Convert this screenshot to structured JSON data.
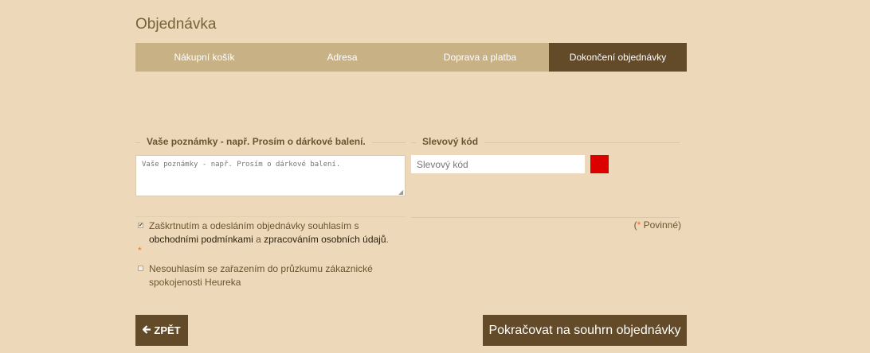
{
  "page": {
    "title": "Objednávka"
  },
  "steps": [
    {
      "label": "Nákupní košík",
      "active": false
    },
    {
      "label": "Adresa",
      "active": false
    },
    {
      "label": "Doprava a platba",
      "active": false
    },
    {
      "label": "Dokončení objednávky",
      "active": true
    }
  ],
  "notes": {
    "legend": "Vaše poznámky - např. Prosím o dárkové balení.",
    "placeholder": "Vaše poznámky - např. Prosím o dárkové balení."
  },
  "discount": {
    "legend": "Slevový kód",
    "placeholder": "Slevový kód",
    "submit_color": "#dd0000"
  },
  "required": {
    "star": "*",
    "label": " Povinné)",
    "open_paren": "("
  },
  "consent_terms": {
    "checked": true,
    "check_mark": "✔",
    "text_before": "Zaškrtnutím a odesláním objednávky souhlasím s ",
    "link_terms": "obchodními podmínkami",
    "text_middle": " a ",
    "link_privacy": "zpracováním osobních údajů",
    "text_after": ".",
    "required_star": "*"
  },
  "consent_heureka": {
    "checked": false,
    "text": "Nesouhlasím se zařazením do průzkumu zákaznické spokojenosti Heureka"
  },
  "buttons": {
    "back_icon": "arrow-left-icon",
    "back_label": "ZPĚT",
    "continue_label": "Pokračovat na souhrn objednávky"
  },
  "colors": {
    "background": "#edd9b9",
    "step_inactive": "#c9b186",
    "step_active": "#634a28",
    "button": "#634a28",
    "accent_star": "#e8742a"
  }
}
